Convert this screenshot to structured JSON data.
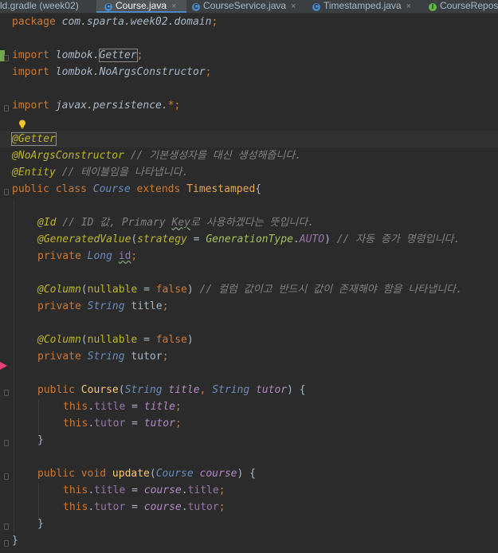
{
  "tabs": [
    {
      "label": "ld.gradle (week02)",
      "icon": "gradle-icon",
      "active": false,
      "closable": false
    },
    {
      "label": "Course.java",
      "icon": "class-icon",
      "active": true,
      "closable": true
    },
    {
      "label": "CourseService.java",
      "icon": "class-icon",
      "active": false,
      "closable": true
    },
    {
      "label": "Timestamped.java",
      "icon": "class-icon",
      "active": false,
      "closable": true
    },
    {
      "label": "CourseRepos",
      "icon": "interface-icon",
      "active": false,
      "closable": false
    }
  ],
  "tab_close_glyph": "×",
  "tab_icon_letters": {
    "class": "C",
    "interface": "I"
  },
  "code": {
    "l1": [
      "package ",
      "com.sparta.week02.domain",
      ";"
    ],
    "l3": [
      "import ",
      "lombok.",
      "Getter",
      ";"
    ],
    "l4": [
      "import ",
      "lombok.NoArgsConstructor",
      ";"
    ],
    "l6": [
      "import ",
      "javax.persistence.",
      "*",
      ";"
    ],
    "l8": [
      "@Getter"
    ],
    "l9": [
      "@NoArgsConstructor",
      " // 기본생성자를 대신 생성해줍니다."
    ],
    "l10": [
      "@Entity",
      " // 테이블임을 나타냅니다."
    ],
    "l11": [
      "public class ",
      "Course ",
      "extends ",
      "Timestamped",
      "{"
    ],
    "l13": [
      "@Id",
      " // ID 값, Primary ",
      "Key",
      "로 사용하겠다는 뜻입니다."
    ],
    "l14": [
      "@GeneratedValue",
      "(",
      "strategy",
      " = ",
      "GenerationType",
      ".",
      "AUTO",
      ") ",
      "// 자동 증가 명령입니다."
    ],
    "l15": [
      "private ",
      "Long ",
      "id",
      ";"
    ],
    "l17": [
      "@Column",
      "(",
      "nullable",
      " = ",
      "false",
      ") ",
      "// 컬럼 값이고 반드시 값이 존재해야 함을 나타냅니다."
    ],
    "l18": [
      "private ",
      "String ",
      "title",
      ";"
    ],
    "l20": [
      "@Column",
      "(",
      "nullable",
      " = ",
      "false",
      ")"
    ],
    "l21": [
      "private ",
      "String ",
      "tutor",
      ";"
    ],
    "l23": [
      "public ",
      "Course",
      "(",
      "String ",
      "title",
      ", ",
      "String ",
      "tutor",
      ") {"
    ],
    "l24": [
      "this",
      ".",
      "title",
      " = ",
      "title",
      ";"
    ],
    "l25": [
      "this",
      ".",
      "tutor",
      " = ",
      "tutor",
      ";"
    ],
    "l26": [
      "}"
    ],
    "l28": [
      "public void ",
      "update",
      "(",
      "Course ",
      "course",
      ") {"
    ],
    "l29": [
      "this",
      ".",
      "title",
      " = ",
      "course",
      ".",
      "title",
      ";"
    ],
    "l30": [
      "this",
      ".",
      "tutor",
      " = ",
      "course",
      ".",
      "tutor",
      ";"
    ],
    "l31": [
      "}"
    ],
    "l32": [
      "}"
    ]
  },
  "colors": {
    "keyword": "#cc7832",
    "annotation": "#bbb529",
    "comment": "#808080",
    "field": "#9876aa",
    "method": "#ffc66d",
    "text": "#a9b7c6",
    "background": "#2b2b2b",
    "current_line": "#323232",
    "breakpoint": "#e5407a",
    "gutter_change": "#73a64e"
  }
}
